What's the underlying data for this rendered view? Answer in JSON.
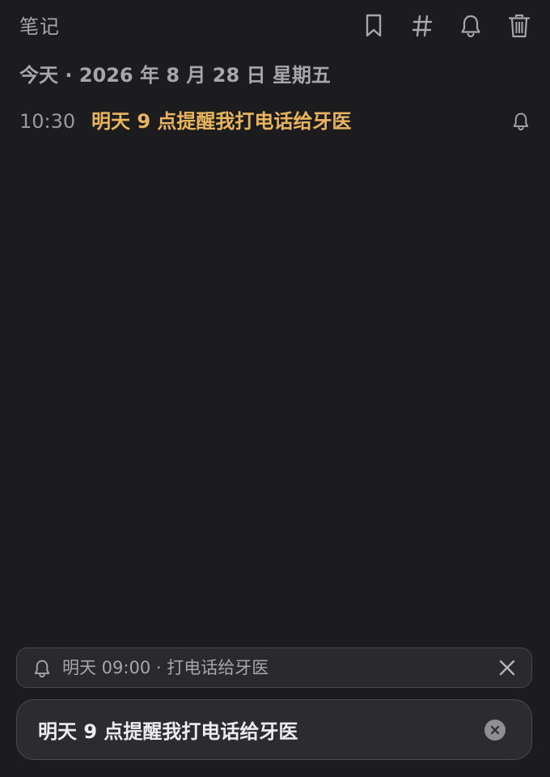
{
  "header": {
    "title": "笔记",
    "actions": [
      {
        "name": "bookmark",
        "icon": "bookmark-icon"
      },
      {
        "name": "tag",
        "icon": "hash-icon"
      },
      {
        "name": "reminder",
        "icon": "bell-icon"
      },
      {
        "name": "delete",
        "icon": "trash-icon"
      }
    ]
  },
  "date_heading": "今天 · 2026 年 8 月 28 日 星期五",
  "notes": [
    {
      "time": "10:30",
      "text": "明天 9 点提醒我打电话给牙医",
      "icon": "bell-icon"
    }
  ],
  "reminder_chip": {
    "icon": "bell-icon",
    "text": "明天 09:00 · 打电话给牙医",
    "close_icon": "close-icon"
  },
  "input": {
    "value": "明天 9 点提醒我打电话给牙医",
    "clear_icon": "clear-icon"
  },
  "colors": {
    "background": "#1c1c1e",
    "accent": "#e8b45d",
    "muted": "#a7a7ab"
  }
}
